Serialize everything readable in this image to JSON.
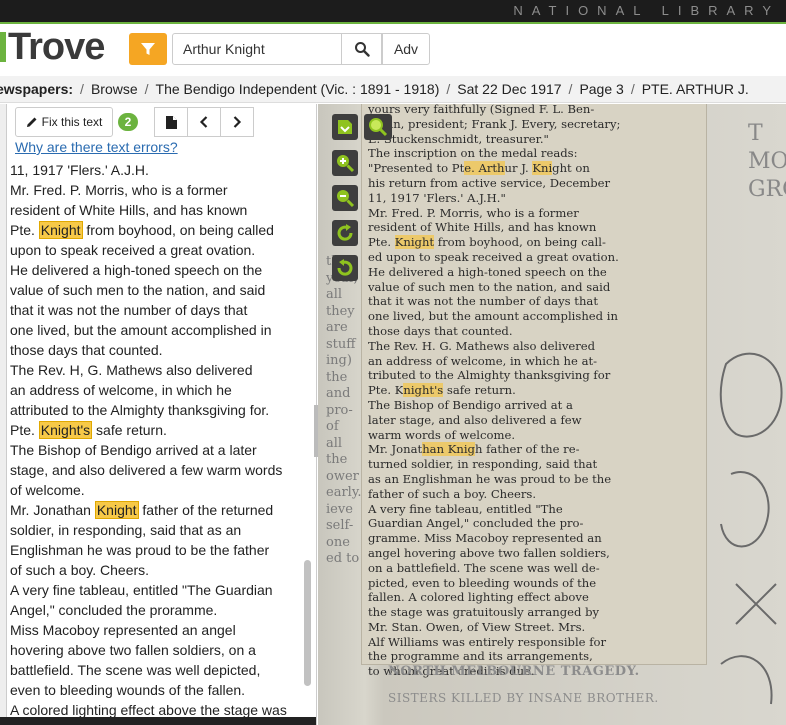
{
  "header": {
    "brand_right": "NATIONAL LIBRARY",
    "logo": "Trove",
    "search_value": "Arthur Knight",
    "adv_label": "Adv"
  },
  "breadcrumb": {
    "items": [
      "ewspapers:",
      "Browse",
      "The Bendigo Independent (Vic. : 1891 - 1918)",
      "Sat 22 Dec 1917",
      "Page 3",
      "PTE. ARTHUR J."
    ]
  },
  "toolbar": {
    "fix_label": "Fix this text",
    "count": "2",
    "error_link": "Why are there text errors?"
  },
  "ocr_lines": [
    [
      {
        "t": "11, 1917 'Flers.' A.J.H."
      }
    ],
    [
      {
        "t": "Mr. Fred. P. Morris, who is a former"
      }
    ],
    [
      {
        "t": "resident of White Hills, and has known"
      }
    ],
    [
      {
        "t": "Pte. "
      },
      {
        "t": "Knight",
        "h": true
      },
      {
        "t": " from boyhood, on being called"
      }
    ],
    [
      {
        "t": "upon to speak received a great ovation."
      }
    ],
    [
      {
        "t": "He delivered a high-toned speech on the"
      }
    ],
    [
      {
        "t": "value of such men to the nation, and said"
      }
    ],
    [
      {
        "t": "that it was not the number of days that"
      }
    ],
    [
      {
        "t": "one lived, but the amount accomplished in"
      }
    ],
    [
      {
        "t": "those days that counted."
      }
    ],
    [
      {
        "t": "The Rev. H, G. Mathews also delivered"
      }
    ],
    [
      {
        "t": "an address of welcome, in which he"
      }
    ],
    [
      {
        "t": "attributed to the Almighty thanksgiving for."
      }
    ],
    [
      {
        "t": "Pte. "
      },
      {
        "t": "Knight's",
        "h": true
      },
      {
        "t": " safe return."
      }
    ],
    [
      {
        "t": "The Bishop of Bendigo arrived at a later"
      }
    ],
    [
      {
        "t": "stage, and also delivered a few warm words"
      }
    ],
    [
      {
        "t": "of welcome."
      }
    ],
    [
      {
        "t": "Mr. Jonathan "
      },
      {
        "t": "Knight",
        "h": true
      },
      {
        "t": " father of the returned"
      }
    ],
    [
      {
        "t": "soldier, in responding, said that as an"
      }
    ],
    [
      {
        "t": "Englishman he was proud to be the father"
      }
    ],
    [
      {
        "t": "of such a boy. Cheers."
      }
    ],
    [
      {
        "t": "A very fine tableau, entitled \"The Guardian"
      }
    ],
    [
      {
        "t": "Angel,\" concluded the proramme."
      }
    ],
    [
      {
        "t": "Miss Macoboy represented an angel"
      }
    ],
    [
      {
        "t": "hovering above two fallen soldiers, on a"
      }
    ],
    [
      {
        "t": "battlefield. The scene was well depicted,"
      }
    ],
    [
      {
        "t": "even to bleeding wounds of the fallen."
      }
    ],
    [
      {
        "t": "A colored lighting effect above the stage was"
      }
    ]
  ],
  "scan_lines": [
    [
      {
        "t": "yours very faithfully (Signed F. L. Ben-"
      }
    ],
    [
      {
        "t": "jamin, president; Frank J. Every, secretary;"
      }
    ],
    [
      {
        "t": "E. Stuckenschmidt, treasurer.\""
      }
    ],
    [
      {
        "t": "   The inscription on the medal reads:"
      }
    ],
    [
      {
        "t": "\"Presented to Pt"
      },
      {
        "t": "e. Arth",
        "h": true
      },
      {
        "t": "ur J. "
      },
      {
        "t": "Kni",
        "h": true
      },
      {
        "t": "ght on"
      }
    ],
    [
      {
        "t": "his return from active service, December"
      }
    ],
    [
      {
        "t": "11, 1917 'Flers.' A.J.H.\""
      }
    ],
    [
      {
        "t": "   Mr. Fred. P. Morris, who is a former"
      }
    ],
    [
      {
        "t": "resident of White Hills, and has known"
      }
    ],
    [
      {
        "t": "Pte. "
      },
      {
        "t": "Knight",
        "h": true
      },
      {
        "t": " from boyhood, on being call-"
      }
    ],
    [
      {
        "t": "ed upon to speak received a great ovation."
      }
    ],
    [
      {
        "t": "He delivered a high-toned speech on the"
      }
    ],
    [
      {
        "t": "value of such men to the nation, and said"
      }
    ],
    [
      {
        "t": "that it was not the number of days that"
      }
    ],
    [
      {
        "t": "one lived, but the amount accomplished in"
      }
    ],
    [
      {
        "t": "those days that counted."
      }
    ],
    [
      {
        "t": "   The Rev. H. G. Mathews also delivered"
      }
    ],
    [
      {
        "t": "an address of welcome, in which he at-"
      }
    ],
    [
      {
        "t": "tributed to the Almighty thanksgiving for"
      }
    ],
    [
      {
        "t": "Pte. K"
      },
      {
        "t": "night's",
        "h": true
      },
      {
        "t": " safe return."
      }
    ],
    [
      {
        "t": "   The Bishop of Bendigo arrived at a"
      }
    ],
    [
      {
        "t": "later stage, and also delivered a few"
      }
    ],
    [
      {
        "t": "warm words of welcome."
      }
    ],
    [
      {
        "t": "   Mr. Jonat"
      },
      {
        "t": "han Knig",
        "h": true
      },
      {
        "t": "h father of the re-"
      }
    ],
    [
      {
        "t": "turned soldier, in responding, said that"
      }
    ],
    [
      {
        "t": "as an Englishman he was proud to be the"
      }
    ],
    [
      {
        "t": "father of such a boy. Cheers."
      }
    ],
    [
      {
        "t": "   A very fine tableau, entitled \"The"
      }
    ],
    [
      {
        "t": "Guardian Angel,\" concluded the pro-"
      }
    ],
    [
      {
        "t": "gramme. Miss Macoboy represented an"
      }
    ],
    [
      {
        "t": "angel hovering above two fallen soldiers,"
      }
    ],
    [
      {
        "t": "on a battlefield. The scene was well de-"
      }
    ],
    [
      {
        "t": "picted, even to bleeding wounds of the"
      }
    ],
    [
      {
        "t": "fallen. A colored lighting effect above"
      }
    ],
    [
      {
        "t": "the stage was gratuitously arranged by"
      }
    ],
    [
      {
        "t": "Mr. Stan. Owen, of View Street. Mrs."
      }
    ],
    [
      {
        "t": "Alf Williams was entirely responsible for"
      }
    ],
    [
      {
        "t": "the programme and its arrangements,"
      }
    ],
    [
      {
        "t": "to whom great credit is due."
      }
    ]
  ],
  "scan_below": {
    "headline": "NORTH MELBOURNE TRAGEDY.",
    "subhead": "SISTERS KILLED BY INSANE BROTHER."
  },
  "scan_left_col": [
    "the",
    "year,",
    "all",
    "they",
    "are",
    "stuff",
    "ing)",
    "the",
    "and",
    "pro-",
    "of",
    "all",
    "the",
    "ower",
    "early.",
    "ieve",
    "self-",
    "one",
    "ed to"
  ],
  "scan_right_col": [
    "T",
    "MO",
    "GRO"
  ],
  "colors": {
    "accent": "#f5a623",
    "brand_green": "#6cb33f",
    "highlight": "#f7c948",
    "link": "#2a6bb0"
  }
}
